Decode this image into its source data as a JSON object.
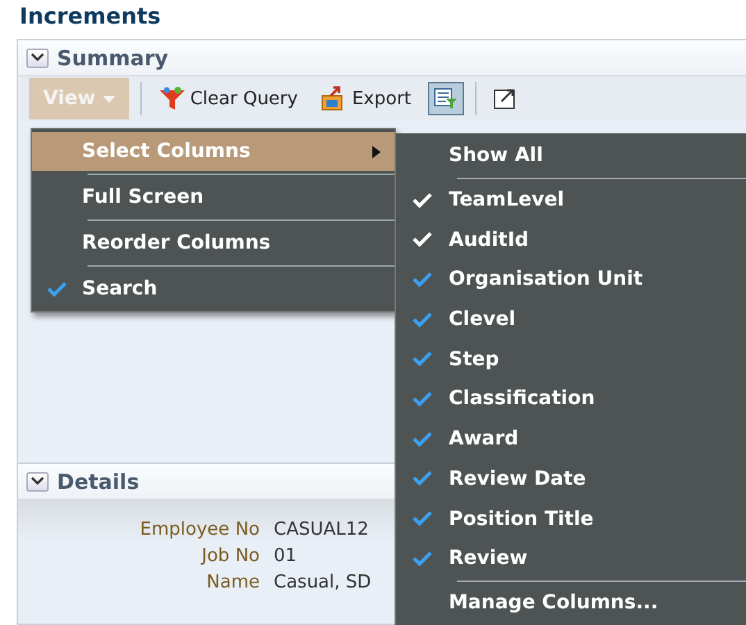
{
  "page_title": "Increments",
  "summary": {
    "title": "Summary",
    "expanded": true
  },
  "toolbar": [
    {
      "kind": "menu",
      "label": "View",
      "selected": true
    },
    {
      "kind": "clear",
      "label": "Clear Query"
    },
    {
      "kind": "export",
      "label": "Export"
    },
    {
      "kind": "filter",
      "selected": true
    },
    {
      "kind": "detach",
      "selected": false
    }
  ],
  "view_menu": [
    {
      "label": "Select Columns",
      "selected": true,
      "submenu": true,
      "checked": false
    },
    {
      "label": "Full Screen",
      "selected": false,
      "submenu": false,
      "checked": false
    },
    {
      "label": "Reorder Columns",
      "selected": false,
      "submenu": false,
      "checked": false
    },
    {
      "label": "Search",
      "selected": false,
      "submenu": false,
      "checked": true
    }
  ],
  "columns_menu": [
    {
      "kind": "command",
      "label": "Show All"
    },
    {
      "kind": "column",
      "label": "TeamLevel",
      "checked": true,
      "required": true
    },
    {
      "kind": "column",
      "label": "AuditId",
      "checked": true,
      "required": true
    },
    {
      "kind": "column",
      "label": "Organisation Unit",
      "checked": true,
      "required": false
    },
    {
      "kind": "column",
      "label": "Clevel",
      "checked": true,
      "required": false
    },
    {
      "kind": "column",
      "label": "Step",
      "checked": true,
      "required": false
    },
    {
      "kind": "column",
      "label": "Classification",
      "checked": true,
      "required": false
    },
    {
      "kind": "column",
      "label": "Award",
      "checked": true,
      "required": false
    },
    {
      "kind": "column",
      "label": "Review Date",
      "checked": true,
      "required": false
    },
    {
      "kind": "column",
      "label": "Position Title",
      "checked": true,
      "required": false
    },
    {
      "kind": "column",
      "label": "Review",
      "checked": true,
      "required": false
    },
    {
      "kind": "command",
      "label": "Manage Columns..."
    }
  ],
  "details": {
    "title": "Details",
    "expanded": true,
    "fields": [
      {
        "label": "Employee No",
        "value": "CASUAL12"
      },
      {
        "label": "Job No",
        "value": "01"
      },
      {
        "label": "Name",
        "value": "Casual, SD"
      }
    ]
  }
}
